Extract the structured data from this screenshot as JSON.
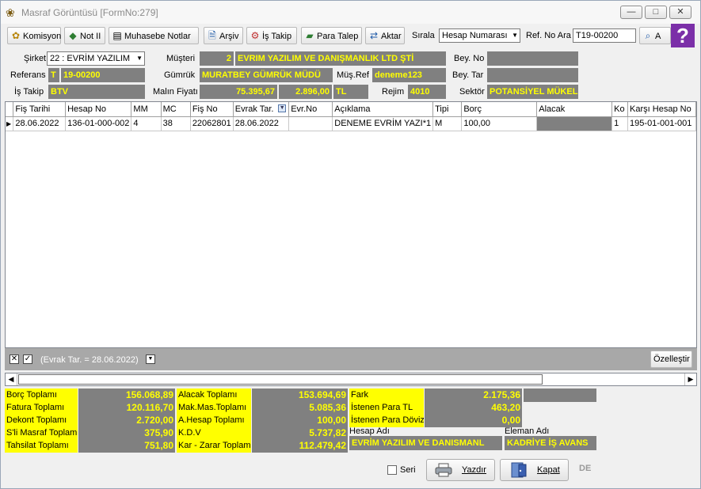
{
  "window": {
    "title": "Masraf Görüntüsü [FormNo:279]",
    "minimize": "—",
    "maximize": "□",
    "close": "✕"
  },
  "toolbar": {
    "komisyon": "Komisyon",
    "not": "Not II",
    "muhasebe_notlar": "Muhasebe Notlar",
    "arsiv": "Arşiv",
    "is_takip": "İş Takip",
    "para_talep": "Para Talep",
    "aktar": "Aktar",
    "sirala_label": "Sırala",
    "sirala_value": "Hesap Numarası",
    "ref_no_label": "Ref. No Ara",
    "ref_no_value": "T19-00200",
    "ara": "A"
  },
  "form": {
    "sirket_label": "Şirket",
    "sirket_value": "22 : EVRİM YAZILIM",
    "referans_label": "Referans",
    "referans_prefix": "T",
    "referans_value": "19-00200",
    "is_takip_label": "İş Takip",
    "is_takip_value": "BTV",
    "musteri_label": "Müşteri",
    "musteri_code": "2",
    "musteri_name": "EVRIM YAZILIM VE DANIŞMANLIK LTD ŞTİ",
    "gumruk_label": "Gümrük",
    "gumruk_value": "MURATBEY GÜMRÜK MÜDÜ",
    "mus_ref_label": "Müş.Ref",
    "mus_ref_value": "deneme123",
    "malin_fiyati_label": "Malın Fiyatı",
    "malin_fiyati_value": "75.395,67",
    "malin_fiyati_value2": "2.896,00",
    "currency": "TL",
    "rejim_label": "Rejim",
    "rejim_value": "4010",
    "bey_no_label": "Bey. No",
    "bey_tar_label": "Bey. Tar",
    "sektor_label": "Sektör",
    "sektor_value": "POTANSİYEL MÜKELL"
  },
  "grid": {
    "columns": [
      "Fiş Tarihi",
      "Hesap No",
      "MM",
      "MC",
      "Fiş No",
      "Evrak Tar.",
      "Evr.No",
      "Açıklama",
      "Tipi",
      "Borç",
      "Alacak",
      "Ko",
      "Karşı Hesap No"
    ],
    "rows": [
      [
        "28.06.2022",
        "136-01-000-002",
        "4",
        "38",
        "22062801",
        "28.06.2022",
        "",
        "DENEME EVRİM YAZI*1",
        "M",
        "100,00",
        "",
        "1",
        "195-01-001-001"
      ]
    ]
  },
  "filter": {
    "text": "(Evrak Tar. = 28.06.2022)",
    "customize": "Özelleştir"
  },
  "totals": {
    "borc_label": "Borç Toplamı",
    "borc_value": "156.068,89",
    "fatura_label": "Fatura Toplamı",
    "fatura_value": "120.116,70",
    "dekont_label": "Dekont Toplamı",
    "dekont_value": "2.720,00",
    "sli_masraf_label": "S'li Masraf Toplamı",
    "sli_masraf_value": "375,90",
    "tahsilat_label": "Tahsilat Toplamı",
    "tahsilat_value": "751,80",
    "alacak_label": "Alacak Toplamı",
    "alacak_value": "153.694,69",
    "mak_mas_label": "Mak.Mas.Toplamı",
    "mak_mas_value": "5.085,36",
    "a_hesap_label": "A.Hesap Toplamı",
    "a_hesap_value": "100,00",
    "kdv_label": "K.D.V",
    "kdv_value": "5.737,82",
    "kar_zarar_label": "Kar - Zarar Toplamı",
    "kar_zarar_value": "112.479,42",
    "fark_label": "Fark",
    "fark_value": "2.175,36",
    "istenen_tl_label": "İstenen Para TL",
    "istenen_tl_value": "463,20",
    "istenen_doviz_label": "İstenen Para Döviz",
    "istenen_doviz_value": "0,00",
    "hesap_adi_label": "Hesap Adı",
    "hesap_adi_value": "EVRİM YAZILIM VE DANISMANL",
    "eleman_adi_label": "Eleman Adı",
    "eleman_adi_value": "KADRİYE İŞ AVANS"
  },
  "footer": {
    "seri": "Seri",
    "yazdir": "Yazdır",
    "kapat": "Kapat",
    "lang": "DE"
  }
}
